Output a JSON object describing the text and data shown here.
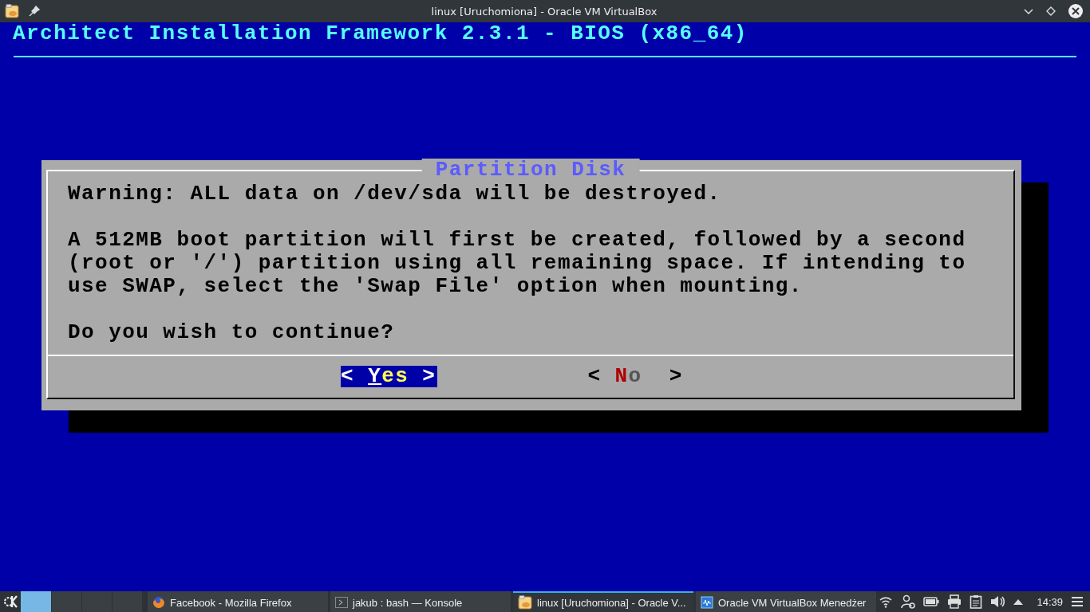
{
  "window": {
    "title": "linux [Uruchomiona] - Oracle VM VirtualBox"
  },
  "console": {
    "header": "Architect Installation Framework 2.3.1 - BIOS (x86_64)",
    "dialog": {
      "title": "Partition Disk",
      "paragraphs": [
        "Warning: ALL data on /dev/sda will be destroyed.",
        "A 512MB boot partition will first be created, followed by a second (root or '/') partition using all remaining space. If intending to use SWAP, select the 'Swap File' option when mounting.",
        "Do you wish to continue?"
      ],
      "buttons": [
        {
          "open": "<",
          "label": "Yes",
          "close": ">",
          "selected": true
        },
        {
          "open": "<",
          "label": "No",
          "close": ">",
          "selected": false
        }
      ]
    }
  },
  "taskbar": {
    "pager": [
      {
        "selected": true
      },
      {
        "selected": false
      },
      {
        "selected": false
      },
      {
        "selected": false
      }
    ],
    "tasks": [
      {
        "kind": "firefox",
        "label": "Facebook - Mozilla Firefox",
        "selected": false
      },
      {
        "kind": "terminal",
        "label": "jakub : bash — Konsole",
        "selected": false
      },
      {
        "kind": "vm",
        "label": "linux [Uruchomiona] - Oracle V...",
        "selected": true
      },
      {
        "kind": "manager",
        "label": "Oracle VM VirtualBox Menedżer",
        "selected": false
      }
    ],
    "clock": "14:39"
  }
}
